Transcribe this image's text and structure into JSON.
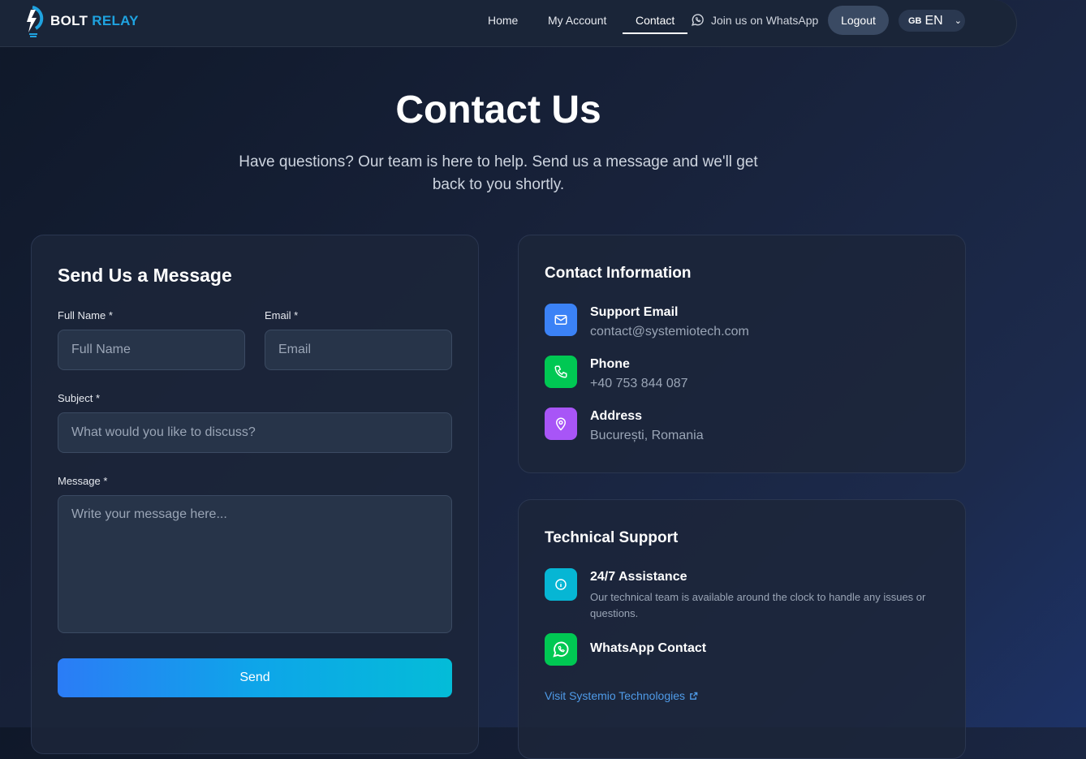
{
  "brand": {
    "part1": "BOLT",
    "part2": "RELAY"
  },
  "nav": {
    "home": "Home",
    "account": "My Account",
    "contact": "Contact",
    "whatsapp": "Join us on WhatsApp",
    "logout": "Logout",
    "lang_flag": "GB",
    "lang": "EN"
  },
  "hero": {
    "title": "Contact Us",
    "subtitle": "Have questions? Our team is here to help. Send us a message and we'll get back to you shortly."
  },
  "form": {
    "title": "Send Us a Message",
    "full_name_label": "Full Name *",
    "full_name_placeholder": "Full Name",
    "email_label": "Email *",
    "email_placeholder": "Email",
    "subject_label": "Subject *",
    "subject_placeholder": "What would you like to discuss?",
    "message_label": "Message *",
    "message_placeholder": "Write your message here...",
    "send": "Send"
  },
  "contact_info": {
    "title": "Contact Information",
    "items": [
      {
        "title": "Support Email",
        "value": "contact@systemiotech.com",
        "icon": "mail-icon",
        "color": "#3b82f6"
      },
      {
        "title": "Phone",
        "value": "+40 753 844 087",
        "icon": "phone-icon",
        "color": "#00c853"
      },
      {
        "title": "Address",
        "value": "București, Romania",
        "icon": "map-pin-icon",
        "color": "#a855f7"
      }
    ]
  },
  "tech_support": {
    "title": "Technical Support",
    "assist_title": "24/7 Assistance",
    "assist_desc": "Our technical team is available around the clock to handle any issues or questions.",
    "whatsapp_title": "WhatsApp Contact",
    "visit_link": "Visit Systemio Technologies",
    "colors": {
      "info": "#06b6d4",
      "whatsapp": "#00c853",
      "link": "#4f9be8"
    }
  }
}
